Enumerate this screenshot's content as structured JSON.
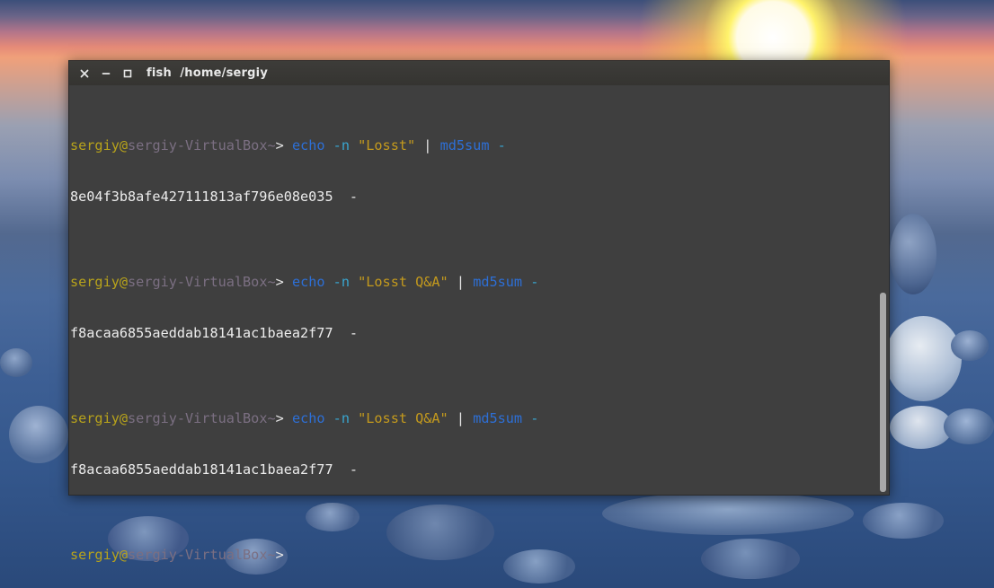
{
  "window": {
    "app_name": "fish",
    "path": "/home/sergiy"
  },
  "terminal": {
    "prompt": {
      "user": "sergiy",
      "at": "@",
      "host": "sergiy-VirtualBox",
      "tilde": "~",
      "gt": "> "
    },
    "commands": [
      {
        "cmd": "echo",
        "opt": "-n",
        "arg": "\"Losst\"",
        "pipe": "|",
        "cmd2": "md5sum",
        "opt2": "-",
        "output": "8e04f3b8afe427111813af796e08e035  -"
      },
      {
        "cmd": "echo",
        "opt": "-n",
        "arg": "\"Losst Q&A\"",
        "pipe": "|",
        "cmd2": "md5sum",
        "opt2": "-",
        "output": "f8acaa6855aeddab18141ac1baea2f77  -"
      },
      {
        "cmd": "echo",
        "opt": "-n",
        "arg": "\"Losst Q&A\"",
        "pipe": "|",
        "cmd2": "md5sum",
        "opt2": "-",
        "output": "f8acaa6855aeddab18141ac1baea2f77  -"
      }
    ]
  },
  "colors": {
    "prompt_user": "#b8a31b",
    "prompt_host": "#7b6f82",
    "command": "#2d6fd6",
    "option": "#39a6d0",
    "string": "#c49a1d",
    "terminal_bg": "#3f3f3f"
  }
}
